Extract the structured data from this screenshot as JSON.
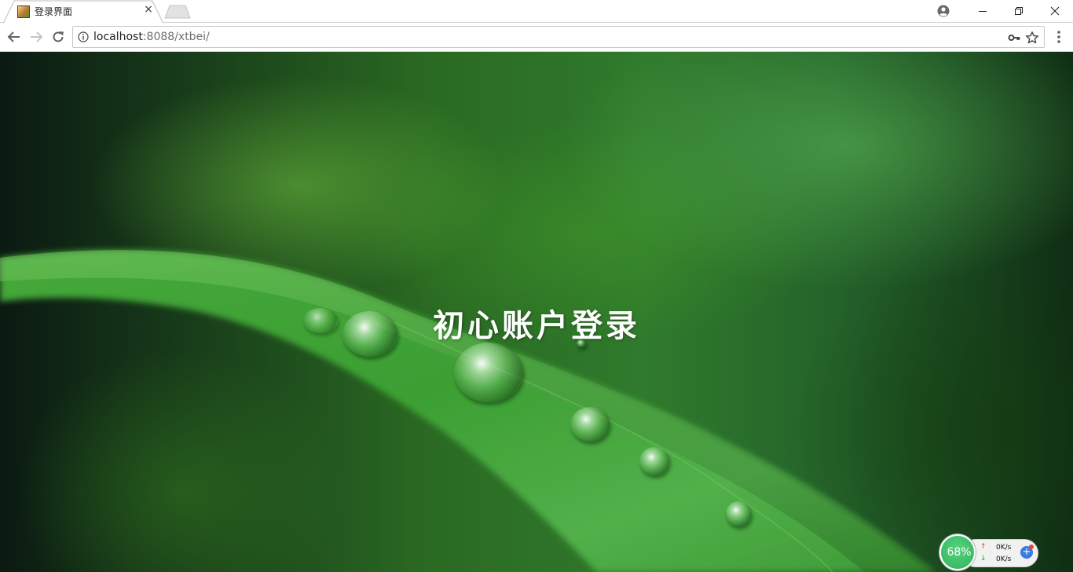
{
  "browser": {
    "tab": {
      "title": "登录界面",
      "close_glyph": "×"
    },
    "window_controls": {
      "minimize": "—",
      "restore": "❐",
      "close": "✕"
    },
    "address": {
      "host": "localhost",
      "rest": ":8088/xtbei/"
    }
  },
  "page": {
    "title": "初心账户登录"
  },
  "widget": {
    "percent": "68%",
    "upload": "0K/s",
    "download": "0K/s",
    "up_arrow": "↑",
    "down_arrow": "↓",
    "plus": "+"
  },
  "icons": {
    "favicon": "image-favicon-icon",
    "info": "info-circle-icon",
    "key": "key-icon",
    "star": "star-icon",
    "menu": "kebab-menu-icon",
    "profile": "account-circle-icon"
  },
  "colors": {
    "widget_green": "#2fb35b",
    "widget_blue": "#3a7be0"
  }
}
